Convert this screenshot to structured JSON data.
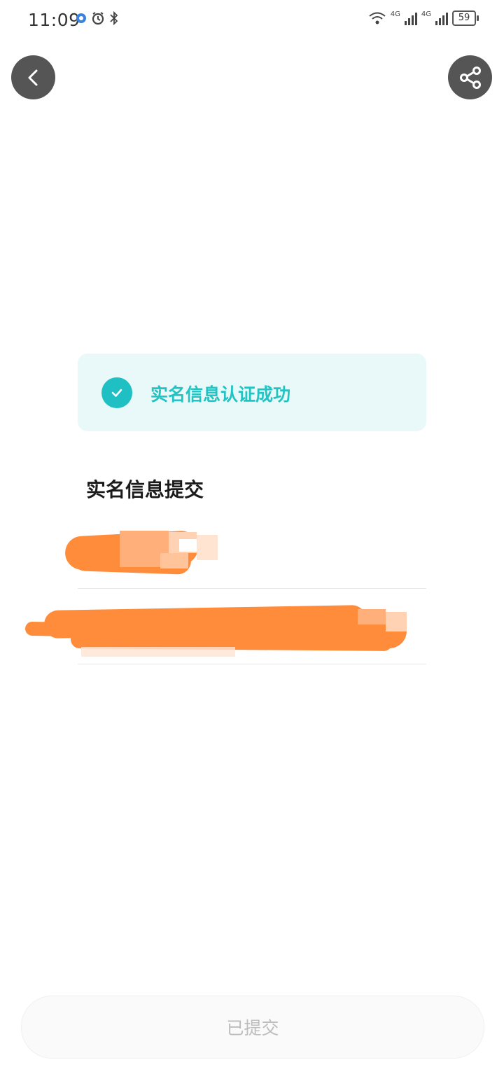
{
  "status_bar": {
    "time": "11:09",
    "battery": "59",
    "network_1": "4G",
    "network_2": "4G"
  },
  "header": {
    "back_icon": "chevron-left-icon",
    "share_icon": "share-icon"
  },
  "success_card": {
    "icon": "check-icon",
    "message": "实名信息认证成功",
    "accent_color": "#22c3c3"
  },
  "section": {
    "title": "实名信息提交"
  },
  "fields": [
    {
      "name": "name-field"
    },
    {
      "name": "id-number-field"
    }
  ],
  "footer": {
    "submit_label": "已提交"
  },
  "colors": {
    "redaction": "#ff8c3b",
    "card_bg": "#e9f8f8"
  }
}
